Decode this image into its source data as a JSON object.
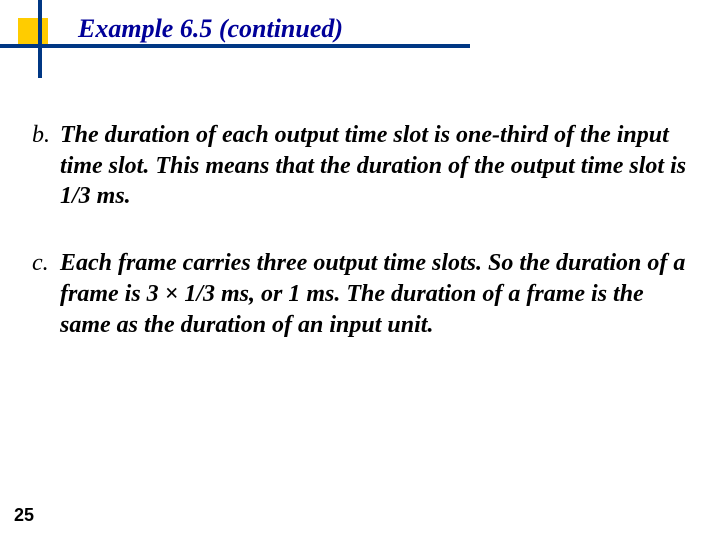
{
  "title": "Example 6.5 (continued)",
  "items": [
    {
      "label": "b.",
      "text": "The duration of each output time slot is one-third of the input time slot. This means that the duration of the output time slot is 1/3 ms."
    },
    {
      "label": "c.",
      "text": "Each frame carries three output time slots. So the duration of a frame is 3 × 1/3 ms, or 1 ms. The duration of a frame is the same as the duration of an input unit."
    }
  ],
  "page_number": "25"
}
